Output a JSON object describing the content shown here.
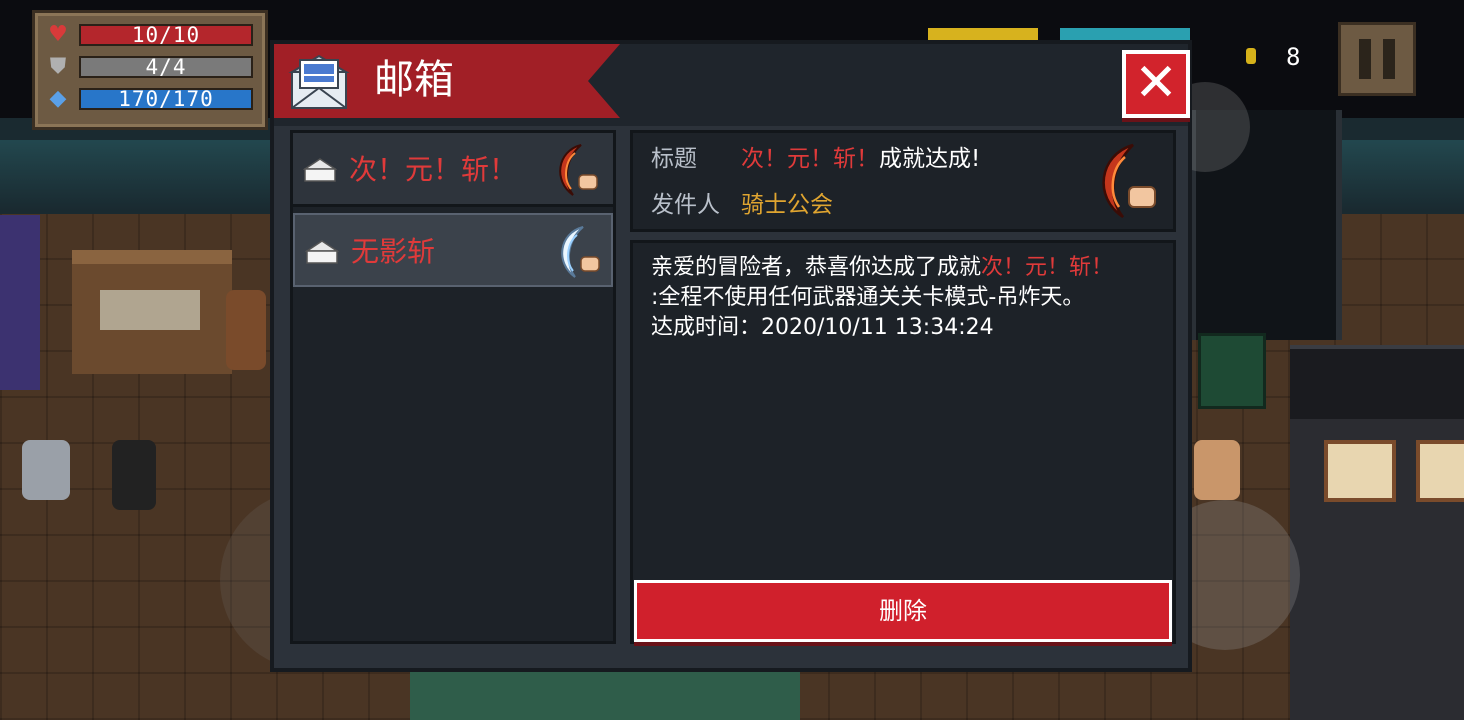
{
  "hud": {
    "hp": {
      "label": "10/10",
      "icon": "heart-icon",
      "color": "#b4262c"
    },
    "armor": {
      "label": "4/4",
      "icon": "shield-icon",
      "color": "#7a7a7a"
    },
    "energy": {
      "label": "170/170",
      "icon": "diamond-icon",
      "color": "#2876c9"
    },
    "gold_count": "8",
    "pause_icon": "pause-icon"
  },
  "mailbox": {
    "title": "邮箱",
    "close_label": "✕",
    "mails": [
      {
        "label": "次！元！斩！",
        "icon": "red-crescent-blade-icon",
        "selected": false
      },
      {
        "label": "无影斩",
        "icon": "white-crescent-blade-icon",
        "selected": true
      }
    ],
    "detail": {
      "subject_label": "标题",
      "subject_highlight": "次！元！斩！",
      "subject_rest": "成就达成!",
      "sender_label": "发件人",
      "sender_value": "骑士公会",
      "body_line1_prefix": "亲爱的冒险者，恭喜你达成了成就",
      "body_line1_highlight": "次！元！斩！",
      "body_line2": ":全程不使用任何武器通关关卡模式-吊炸天。",
      "body_line3": "达成时间：2020/10/11 13:34:24"
    },
    "delete_label": "删除"
  },
  "colors": {
    "accent_red": "#d0202c",
    "highlight_red": "#e03a3a",
    "sender_gold": "#e0a530",
    "panel_bg": "#1d2228"
  }
}
